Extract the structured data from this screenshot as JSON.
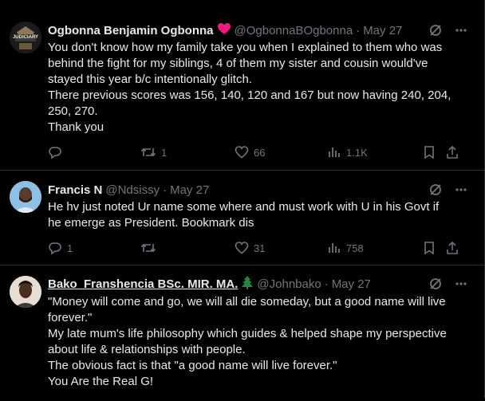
{
  "tweets": [
    {
      "name": "Ogbonna Benjamin Ogbonna",
      "handle": "@OgbonnaBOgbonna",
      "date": "May 27",
      "avatar_text": "JUDICIARY",
      "lines": [
        "You don't know how my family take you when I explained to them who was",
        "behind the fight for my siblings, 4 of them my sister and cousin would've",
        "stayed this year b/c intentionally glitch.",
        "There previous scores was 156, 140, 120 and 167 but now having 240, 204,",
        "250, 270.",
        "Thank you"
      ],
      "replies": "",
      "retweets": "1",
      "likes": "66",
      "views": "1.1K"
    },
    {
      "name": "Francis N",
      "handle": "@Ndsissy",
      "date": "May 27",
      "lines": [
        "He hv just noted Ur name some where and must work with U in his Govt if",
        "he emerge as President. Bookmark dis"
      ],
      "replies": "1",
      "retweets": "",
      "likes": "31",
      "views": "758"
    },
    {
      "name": "Bako_Franshencia BSc. MIR. MA.",
      "handle": "@Johnbako",
      "date": "May 27",
      "lines": [
        "\"Money will come and go, we will all die someday, but a good name will live",
        "forever.\"",
        "My late mum's life philosophy which guides & helped shape my perspective",
        "about life & relationships with people.",
        "The obvious fact is that \"a good name will live forever.\"",
        "You Are the Real G!"
      ]
    }
  ],
  "dot": "·",
  "colors": {
    "background": "#000000",
    "text": "#e7e9ea",
    "muted": "#71767b",
    "divider": "#2f3336",
    "heart": "#f91880",
    "tree": "#1e8a3e"
  },
  "icons": [
    "grok-icon",
    "more-icon",
    "reply-icon",
    "retweet-icon",
    "like-icon",
    "views-icon",
    "bookmark-icon",
    "share-icon",
    "heart-emoji-icon",
    "christmas-tree-emoji-icon"
  ]
}
